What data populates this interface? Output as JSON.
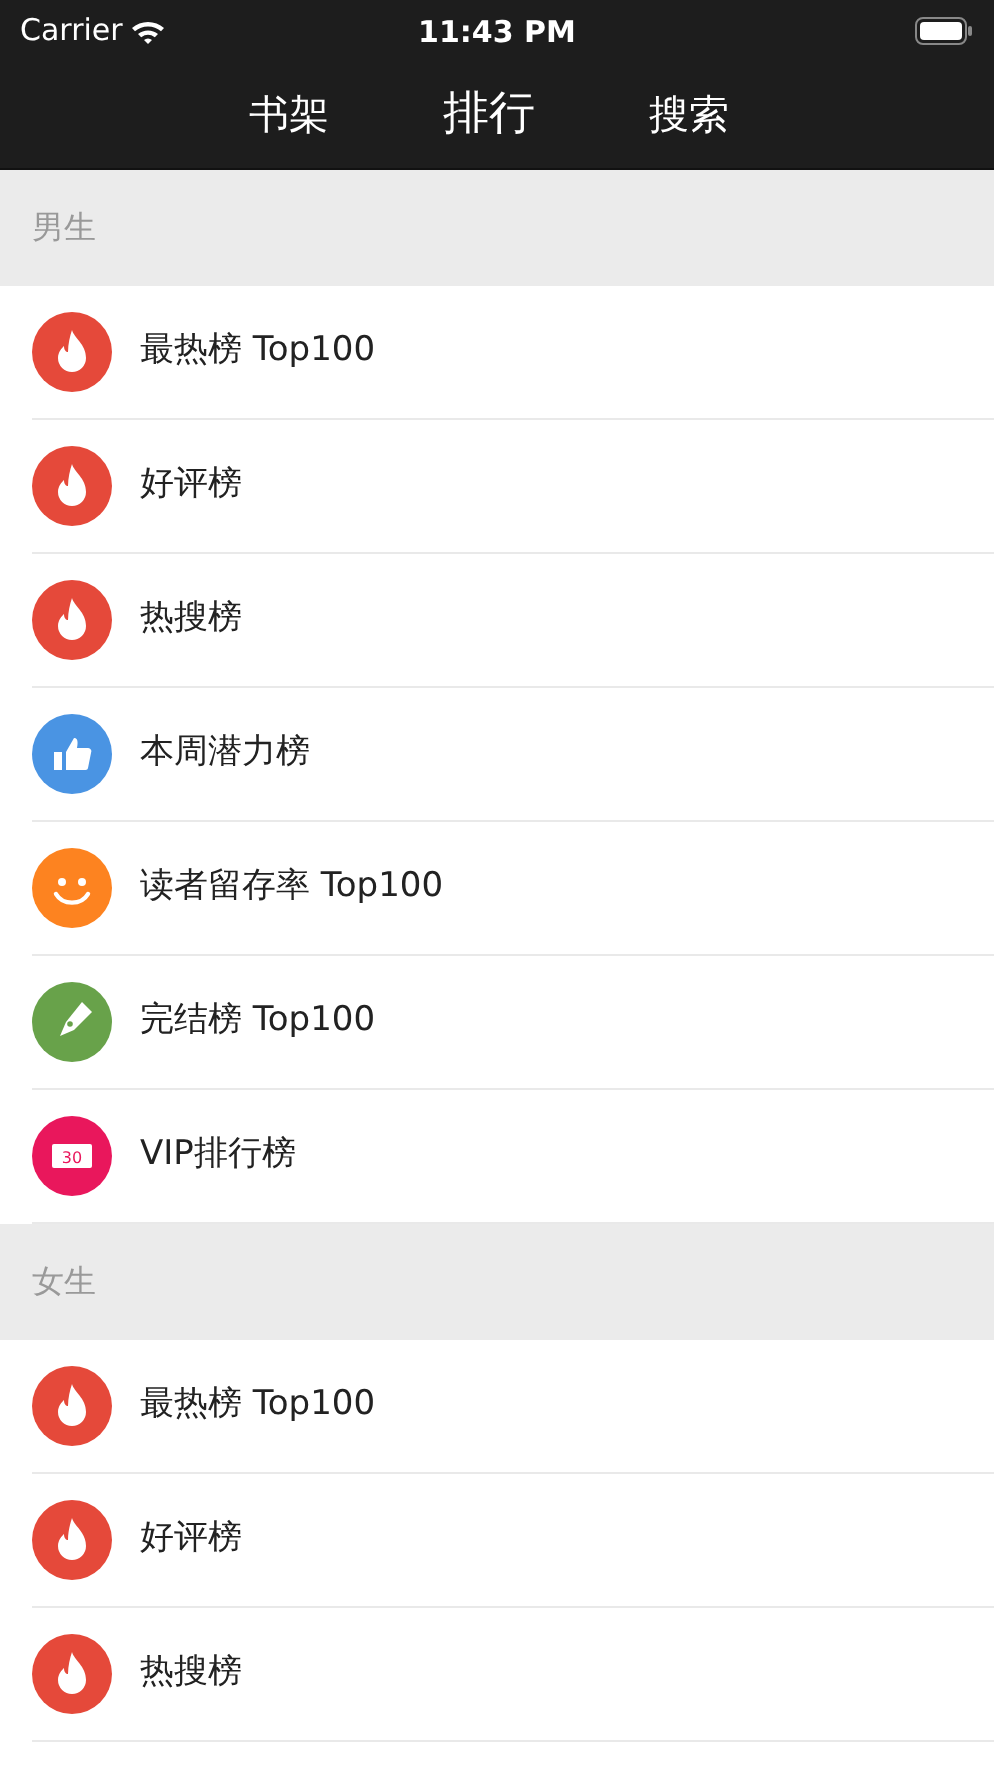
{
  "status_bar": {
    "carrier": "Carrier",
    "time": "11:43 PM"
  },
  "tabs": [
    {
      "label": "书架",
      "selected": false
    },
    {
      "label": "排行",
      "selected": true
    },
    {
      "label": "搜索",
      "selected": false
    }
  ],
  "sections": [
    {
      "title": "男生",
      "items": [
        {
          "label": "最热榜 Top100",
          "kind": "flame",
          "color": "#e5493a"
        },
        {
          "label": "好评榜",
          "kind": "flame",
          "color": "#e5493a"
        },
        {
          "label": "热搜榜",
          "kind": "flame",
          "color": "#e5493a"
        },
        {
          "label": "本周潜力榜",
          "kind": "thumb",
          "color": "#4a94e3"
        },
        {
          "label": "读者留存率 Top100",
          "kind": "smile",
          "color": "#fd8320"
        },
        {
          "label": "完结榜 Top100",
          "kind": "pen",
          "color": "#68a24a"
        },
        {
          "label": "VIP排行榜",
          "kind": "ticket",
          "color": "#e9175c",
          "icon_text": "30"
        }
      ]
    },
    {
      "title": "女生",
      "items": [
        {
          "label": "最热榜 Top100",
          "kind": "flame",
          "color": "#e5493a"
        },
        {
          "label": "好评榜",
          "kind": "flame",
          "color": "#e5493a"
        },
        {
          "label": "热搜榜",
          "kind": "flame",
          "color": "#e5493a"
        }
      ]
    }
  ]
}
